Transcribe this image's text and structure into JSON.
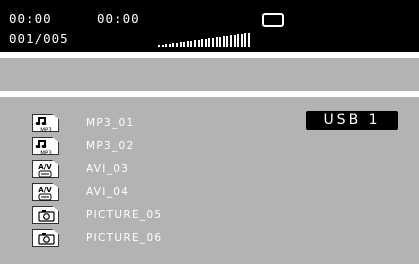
{
  "status_bar": {
    "elapsed_time": "00:00",
    "total_time": "00:00",
    "track_counter": "001/005",
    "status_icon": "rounded-rectangle-icon",
    "level_meter": {
      "bars": 26
    }
  },
  "source_label": "USB 1",
  "files": [
    {
      "name": "MP3_01",
      "type": "mp3",
      "icon": "mp3-file-icon",
      "icon_text": "MP3"
    },
    {
      "name": "MP3_02",
      "type": "mp3",
      "icon": "mp3-file-icon",
      "icon_text": "MP3"
    },
    {
      "name": "AVI_03",
      "type": "avi",
      "icon": "av-file-icon",
      "icon_text": "A/V"
    },
    {
      "name": "AVI_04",
      "type": "avi",
      "icon": "av-file-icon",
      "icon_text": "A/V"
    },
    {
      "name": "PICTURE_05",
      "type": "picture",
      "icon": "camera-file-icon"
    },
    {
      "name": "PICTURE_06",
      "type": "picture",
      "icon": "camera-file-icon"
    }
  ],
  "colors": {
    "status_bar_bg": "#000000",
    "panel_bg": "#b3b3b3",
    "text": "#ffffff",
    "usb_badge_bg": "#000000"
  }
}
